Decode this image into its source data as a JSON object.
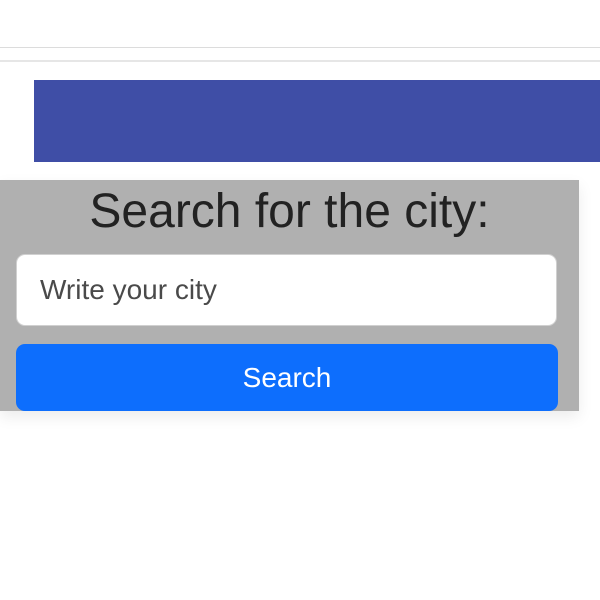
{
  "search": {
    "title": "Search for the city:",
    "input_placeholder": "Write your city",
    "input_value": "",
    "button_label": "Search"
  },
  "colors": {
    "banner": "#3f4ea6",
    "panel": "#b0b0b0",
    "button": "#0d6efd"
  }
}
